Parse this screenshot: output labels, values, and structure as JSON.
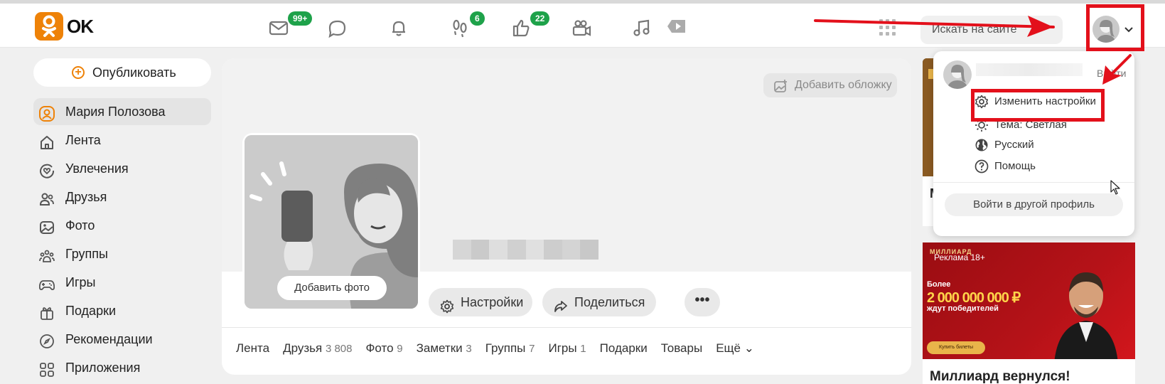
{
  "header": {
    "logo_text": "OK",
    "nav": [
      {
        "icon": "mail-icon",
        "badge": "99+"
      },
      {
        "icon": "chat-icon",
        "badge": ""
      },
      {
        "icon": "bell-icon",
        "badge": ""
      },
      {
        "icon": "footprints-icon",
        "badge": "6"
      },
      {
        "icon": "thumbs-up-icon",
        "badge": "22"
      },
      {
        "icon": "video-camera-icon",
        "badge": ""
      },
      {
        "icon": "music-icon",
        "badge": ""
      },
      {
        "icon": "video-play-icon",
        "badge": ""
      }
    ],
    "search_placeholder": "Искать на сайте",
    "accent_color": "#ee8208",
    "annotation_color": "#e3101b"
  },
  "sidebar": {
    "publish_label": "Опубликовать",
    "items": [
      {
        "label": "Мария Полозова",
        "icon": "user-icon",
        "active": true
      },
      {
        "label": "Лента",
        "icon": "home-icon"
      },
      {
        "label": "Увлечения",
        "icon": "heart-circle-icon"
      },
      {
        "label": "Друзья",
        "icon": "friends-icon"
      },
      {
        "label": "Фото",
        "icon": "photo-icon"
      },
      {
        "label": "Группы",
        "icon": "groups-icon"
      },
      {
        "label": "Игры",
        "icon": "gamepad-icon"
      },
      {
        "label": "Подарки",
        "icon": "gift-icon"
      },
      {
        "label": "Рекомендации",
        "icon": "compass-icon"
      },
      {
        "label": "Приложения",
        "icon": "apps-icon"
      }
    ]
  },
  "profile": {
    "add_cover_label": "Добавить обложку",
    "add_photo_label": "Добавить фото",
    "settings_label": "Настройки",
    "share_label": "Поделиться",
    "more_label": "•••",
    "tabs": [
      {
        "label": "Лента",
        "count": ""
      },
      {
        "label": "Друзья",
        "count": "3 808"
      },
      {
        "label": "Фото",
        "count": "9"
      },
      {
        "label": "Заметки",
        "count": "3"
      },
      {
        "label": "Группы",
        "count": "7"
      },
      {
        "label": "Игры",
        "count": "1"
      },
      {
        "label": "Подарки",
        "count": ""
      },
      {
        "label": "Товары",
        "count": ""
      },
      {
        "label": "Ещё ⌄",
        "count": ""
      }
    ]
  },
  "dropdown": {
    "logout_label": "Выйти",
    "items": [
      {
        "label": "Изменить настройки",
        "icon": "gear-icon"
      },
      {
        "label": "Тема: Светлая",
        "icon": "sun-icon"
      },
      {
        "label": "Русский",
        "icon": "globe-icon"
      },
      {
        "label": "Помощь",
        "icon": "help-icon"
      }
    ],
    "switch_profile_label": "Войти в другой профиль"
  },
  "ads": {
    "top_caption_letter": "М",
    "bottom_brand": "МИЛЛИАРД",
    "bottom_label": "Реклама 18+",
    "bottom_line1": "Более",
    "bottom_line2": "2 000 000 000 ₽",
    "bottom_line3": "ждут победителей",
    "bottom_cta": "Купить билеты",
    "bottom_title": "Миллиард вернулся!"
  }
}
